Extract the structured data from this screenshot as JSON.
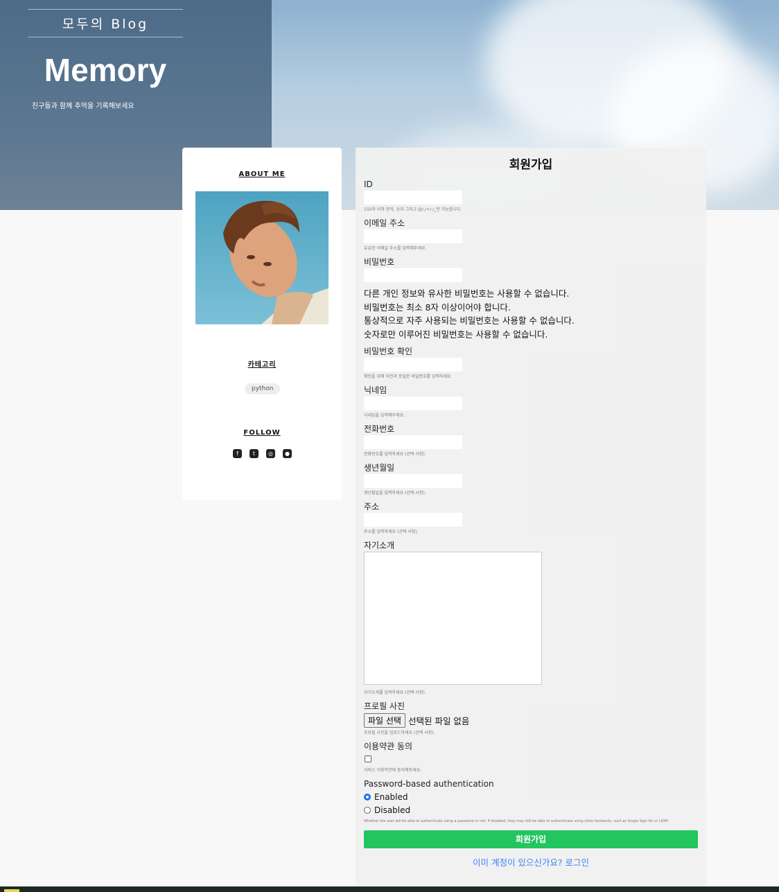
{
  "header": {
    "site_name": "모두의 Blog",
    "title": "Memory",
    "tagline": "친구들과 함께 추억을 기록해보세요"
  },
  "sidebar": {
    "about_heading": "ABOUT ME",
    "category_heading": "카테고리",
    "categories": [
      "python"
    ],
    "follow_heading": "FOLLOW",
    "social_icons": [
      "facebook-icon",
      "twitter-icon",
      "instagram-icon",
      "github-icon"
    ]
  },
  "signup": {
    "title": "회원가입",
    "fields": {
      "id": {
        "label": "ID",
        "help": "150자 이하 문자, 숫자 그리고 @/./+/-/_만 가능합니다."
      },
      "email": {
        "label": "이메일 주소",
        "help": "유효한 이메일 주소를 입력해주세요."
      },
      "password": {
        "label": "비밀번호",
        "rules": [
          "다른 개인 정보와 유사한 비밀번호는 사용할 수 없습니다.",
          "비밀번호는 최소 8자 이상이어야 합니다.",
          "통상적으로 자주 사용되는 비밀번호는 사용할 수 없습니다.",
          "숫자로만 이루어진 비밀번호는 사용할 수 없습니다."
        ]
      },
      "password_confirm": {
        "label": "비밀번호 확인",
        "help": "확인을 위해 이전과 동일한 비밀번호를 입력하세요."
      },
      "nickname": {
        "label": "닉네임",
        "help": "닉네임을 입력해주세요."
      },
      "phone": {
        "label": "전화번호",
        "help": "전화번호를 입력하세요 (선택 사항)."
      },
      "birthdate": {
        "label": "생년월일",
        "help": "생년월일을 입력하세요 (선택 사항)."
      },
      "address": {
        "label": "주소",
        "help": "주소를 입력하세요 (선택 사항)."
      },
      "bio": {
        "label": "자기소개",
        "help": "자기소개를 입력하세요 (선택 사항)."
      },
      "profile_image": {
        "label": "프로필 사진",
        "button": "파일 선택",
        "status": "선택된 파일 없음",
        "help": "프로필 사진을 업로드하세요 (선택 사항)."
      },
      "terms": {
        "label": "이용약관 동의",
        "help": "서비스 이용약관에 동의해주세요.",
        "checked": false
      },
      "password_auth": {
        "label": "Password-based authentication",
        "options": [
          "Enabled",
          "Disabled"
        ],
        "selected": "Enabled",
        "help": "Whether the user will be able to authenticate using a password or not. If disabled, they may still be able to authenticate using other backends, such as Single Sign-On or LDAP."
      }
    },
    "submit_label": "회원가입",
    "login_link": "이미 계정이 있으신가요? 로그인"
  },
  "colors": {
    "submit_button": "#22c55e",
    "link": "#3b82f6",
    "radio_selected": "#1a73e8"
  }
}
